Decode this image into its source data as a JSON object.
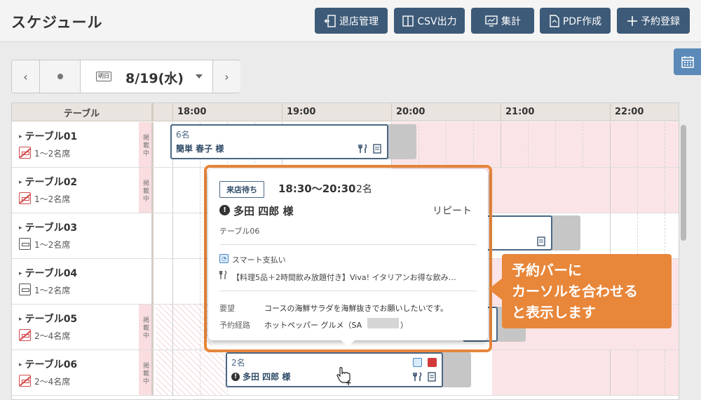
{
  "page_title": "スケジュール",
  "toolbar": {
    "checkout": "退店管理",
    "csv": "CSV出力",
    "summary": "集計",
    "pdf": "PDF作成",
    "add": "予約登録"
  },
  "date_nav": {
    "badge": "明日",
    "date": "8/19(水)"
  },
  "grid": {
    "header_table": "テーブル",
    "times": [
      "18:00",
      "19:00",
      "20:00",
      "21:00",
      "22:00"
    ],
    "kisai_label": "掲載中",
    "rows": [
      {
        "name": "テーブル01",
        "seats": "1〜2名席"
      },
      {
        "name": "テーブル02",
        "seats": "1〜2名席"
      },
      {
        "name": "テーブル03",
        "seats": "1〜2名席"
      },
      {
        "name": "テーブル04",
        "seats": "1〜2名席"
      },
      {
        "name": "テーブル05",
        "seats": "2〜4名席"
      },
      {
        "name": "テーブル06",
        "seats": "2〜4名席"
      }
    ]
  },
  "bars": {
    "bar1": {
      "count": "6名",
      "name": "簡単 春子 様"
    },
    "bar6": {
      "count": "2名",
      "name": "多田 四郎 様"
    }
  },
  "popup": {
    "status": "来店待ち",
    "time": "18:30〜20:30",
    "party": "2名",
    "name": "多田 四郎 様",
    "repeat": "リピート",
    "table": "テーブル06",
    "payment": "スマート支払い",
    "course": "【料理5品＋2時間飲み放題付き】Viva! イタリアンお得な飲み…",
    "request_label": "要望",
    "request_value": "コースの海鮮サラダを海鮮抜きでお願いしたいです。",
    "route_label": "予約経路",
    "route_value": "ホットペッパー グルメ（SA",
    "route_end": "）"
  },
  "callout": {
    "text": "予約バーに\nカーソルを合わせる\nと表示します"
  },
  "colors": {
    "toolbar_button": "#3d5a78",
    "accent_orange": "#e8863a",
    "pink_unavailable": "#fbe4e7"
  }
}
